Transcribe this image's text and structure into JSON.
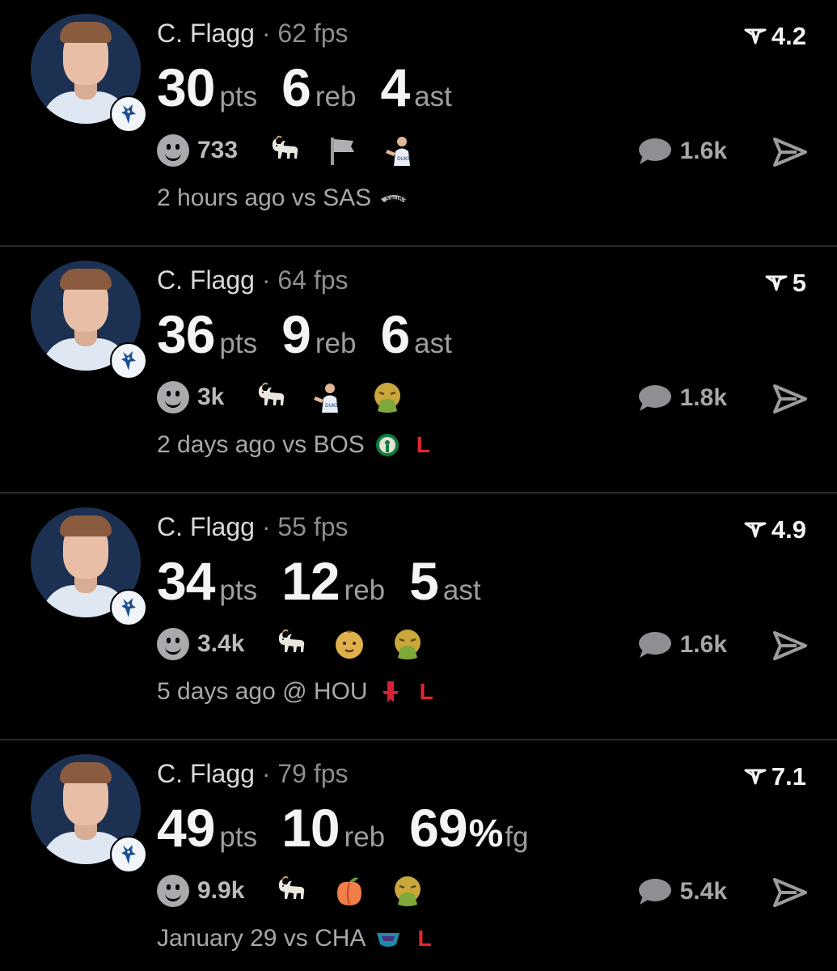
{
  "cards": [
    {
      "player": "C. Flagg",
      "separator": "·",
      "fps": "62 fps",
      "rating": "4.2",
      "stats": [
        {
          "value": "30",
          "unit": "pts"
        },
        {
          "value": "6",
          "unit": "reb"
        },
        {
          "value": "4",
          "unit": "ast"
        }
      ],
      "reactions_count": "733",
      "emojis": [
        "goat-icon",
        "flag-icon",
        "player-icon"
      ],
      "comments": "1.6k",
      "time": "2 hours ago vs SAS",
      "opponent_logo": "spurs-logo",
      "result": ""
    },
    {
      "player": "C. Flagg",
      "separator": "·",
      "fps": "64 fps",
      "rating": "5",
      "stats": [
        {
          "value": "36",
          "unit": "pts"
        },
        {
          "value": "9",
          "unit": "reb"
        },
        {
          "value": "6",
          "unit": "ast"
        }
      ],
      "reactions_count": "3k",
      "emojis": [
        "goat-icon",
        "player-icon",
        "vomit-icon"
      ],
      "comments": "1.8k",
      "time": "2 days ago vs BOS",
      "opponent_logo": "celtics-logo",
      "result": "L"
    },
    {
      "player": "C. Flagg",
      "separator": "·",
      "fps": "55 fps",
      "rating": "4.9",
      "stats": [
        {
          "value": "34",
          "unit": "pts"
        },
        {
          "value": "12",
          "unit": "reb"
        },
        {
          "value": "5",
          "unit": "ast"
        }
      ],
      "reactions_count": "3.4k",
      "emojis": [
        "goat-icon",
        "baby-icon",
        "vomit-icon"
      ],
      "comments": "1.6k",
      "time": "5 days ago @ HOU",
      "opponent_logo": "rockets-logo",
      "result": "L"
    },
    {
      "player": "C. Flagg",
      "separator": "·",
      "fps": "79 fps",
      "rating": "7.1",
      "stats": [
        {
          "value": "49",
          "unit": "pts"
        },
        {
          "value": "10",
          "unit": "reb"
        },
        {
          "value": "69",
          "pct": "%",
          "unit": "fg"
        }
      ],
      "reactions_count": "9.9k",
      "emojis": [
        "goat-icon",
        "peach-icon",
        "vomit-icon"
      ],
      "comments": "5.4k",
      "time": "January 29 vs CHA",
      "opponent_logo": "hornets-logo",
      "result": "L"
    }
  ]
}
